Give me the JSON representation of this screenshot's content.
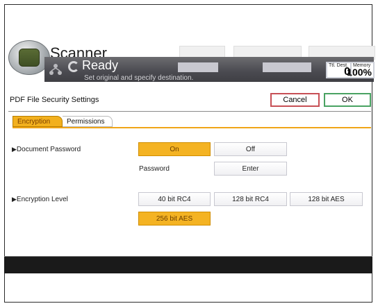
{
  "app": {
    "title": "Scanner"
  },
  "status": {
    "ready_text": "Ready",
    "sub_text": "Set original and specify destination."
  },
  "counter": {
    "label": "Ttl. Dest.",
    "value": "0"
  },
  "memory": {
    "label": "Memory",
    "value": "100%"
  },
  "dialog": {
    "title": "PDF File Security Settings",
    "cancel_label": "Cancel",
    "ok_label": "OK"
  },
  "tabs": [
    {
      "label": "Encryption",
      "active": true
    },
    {
      "label": "Permissions",
      "active": false
    }
  ],
  "document_password": {
    "label": "Document Password",
    "options": [
      {
        "label": "On",
        "selected": true
      },
      {
        "label": "Off",
        "selected": false
      }
    ],
    "password_label": "Password",
    "enter_label": "Enter"
  },
  "encryption_level": {
    "label": "Encryption Level",
    "options": [
      {
        "label": "40 bit RC4",
        "selected": false
      },
      {
        "label": "128 bit RC4",
        "selected": false
      },
      {
        "label": "128 bit AES",
        "selected": false
      },
      {
        "label": "256 bit AES",
        "selected": true
      }
    ]
  },
  "colors": {
    "accent": "#f4b323",
    "cancel_border": "#c74f55",
    "ok_border": "#49a262",
    "status_bar": "#4a4a50"
  },
  "icons": [
    "scanner-logo-icon",
    "network-status-icon",
    "ready-spinner-icon",
    "triangle-right-icon"
  ]
}
